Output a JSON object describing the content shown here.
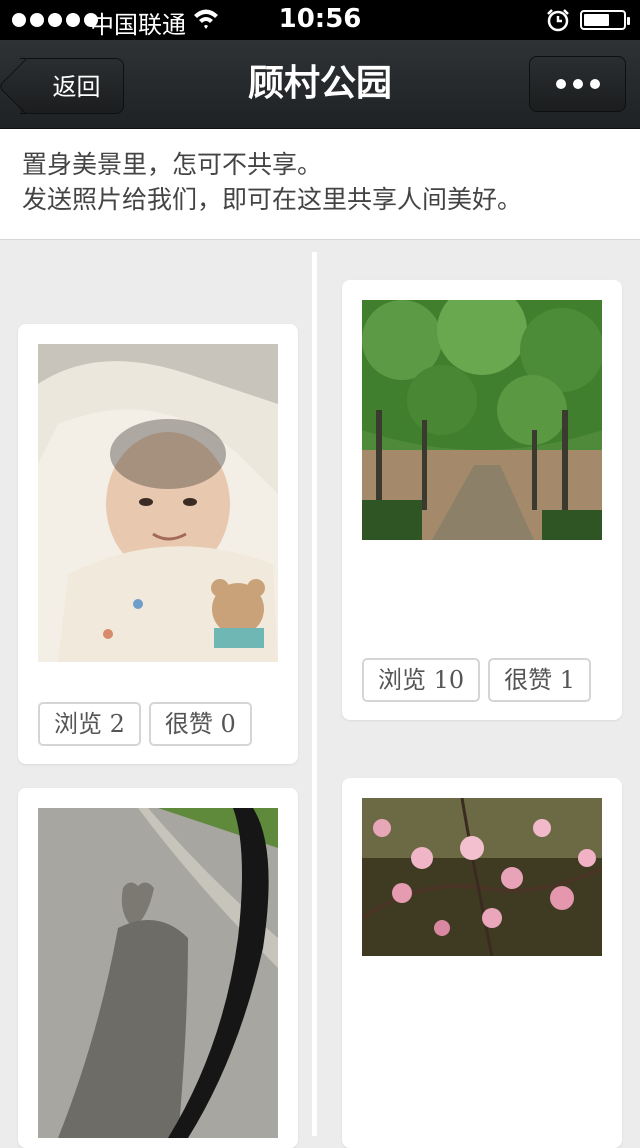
{
  "status_bar": {
    "carrier": "中国联通",
    "time": "10:56"
  },
  "nav": {
    "back_label": "返回",
    "title": "顾村公园"
  },
  "intro": {
    "line1": "置身美景里，怎可不共享。",
    "line2": "发送照片给我们，即可在这里共享人间美好。"
  },
  "cards": [
    {
      "views_label": "浏览 2",
      "likes_label": "很赞 0"
    },
    {
      "views_label": "浏览 10",
      "likes_label": "很赞 1"
    }
  ],
  "colors": {
    "nav_bg": "#2a2d2f",
    "page_bg": "#ececec",
    "card_bg": "#ffffff"
  }
}
